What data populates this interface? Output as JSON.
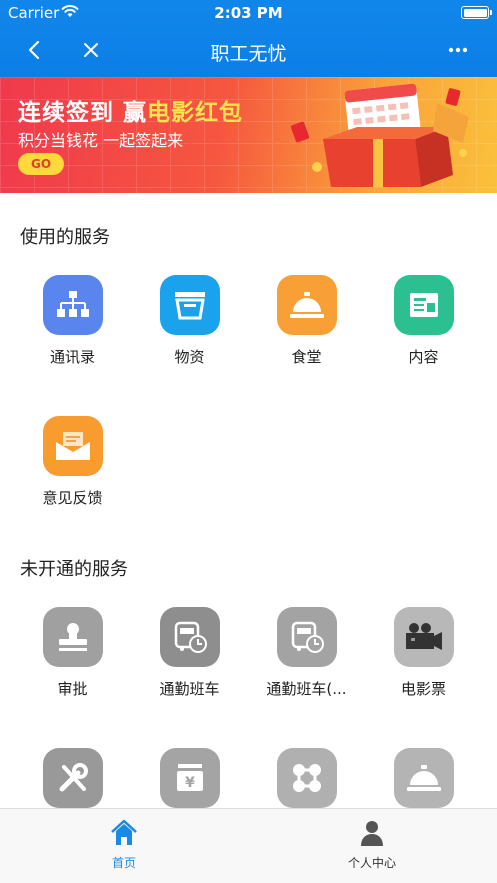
{
  "status": {
    "carrier": "Carrier",
    "time": "2:03 PM"
  },
  "nav": {
    "title": "职工无忧"
  },
  "banner": {
    "headline_part1": "连续签到 ",
    "headline_part2": "赢",
    "headline_part3": "电影红包",
    "subline": "积分当钱花 一起签起来",
    "go_label": "GO"
  },
  "sections": {
    "used_title": "使用的服务",
    "unused_title": "未开通的服务"
  },
  "used_services": [
    {
      "label": "通讯录",
      "icon": "org-chart-icon",
      "color": "#5a85ef"
    },
    {
      "label": "物资",
      "icon": "inbox-tray-icon",
      "color": "#1aa3ec"
    },
    {
      "label": "食堂",
      "icon": "service-bell-icon",
      "color": "#f8a035"
    },
    {
      "label": "内容",
      "icon": "news-card-icon",
      "color": "#2cc090"
    },
    {
      "label": "意见反馈",
      "icon": "mail-envelope-icon",
      "color": "#f89c2f"
    }
  ],
  "unused_services": [
    {
      "label": "审批",
      "icon": "stamp-icon",
      "color": "#a0a0a0"
    },
    {
      "label": "通勤班车",
      "icon": "bus-clock-icon",
      "color": "#8e8e8e"
    },
    {
      "label": "通勤班车(...",
      "icon": "bus-clock-icon",
      "color": "#a3a3a3"
    },
    {
      "label": "电影票",
      "icon": "movie-camera-icon",
      "color": "#b8b8b8"
    },
    {
      "label": "",
      "icon": "tools-icon",
      "color": "#999999"
    },
    {
      "label": "",
      "icon": "yuan-money-icon",
      "color": "#a4a4a4"
    },
    {
      "label": "",
      "icon": "nodes-icon",
      "color": "#b0b0b0"
    },
    {
      "label": "",
      "icon": "service-bell-icon",
      "color": "#b4b4b4"
    }
  ],
  "tabs": [
    {
      "label": "首页",
      "icon": "home-icon",
      "active": true,
      "color": "#1a8ae6"
    },
    {
      "label": "个人中心",
      "icon": "person-icon",
      "active": false,
      "color": "#555555"
    }
  ]
}
